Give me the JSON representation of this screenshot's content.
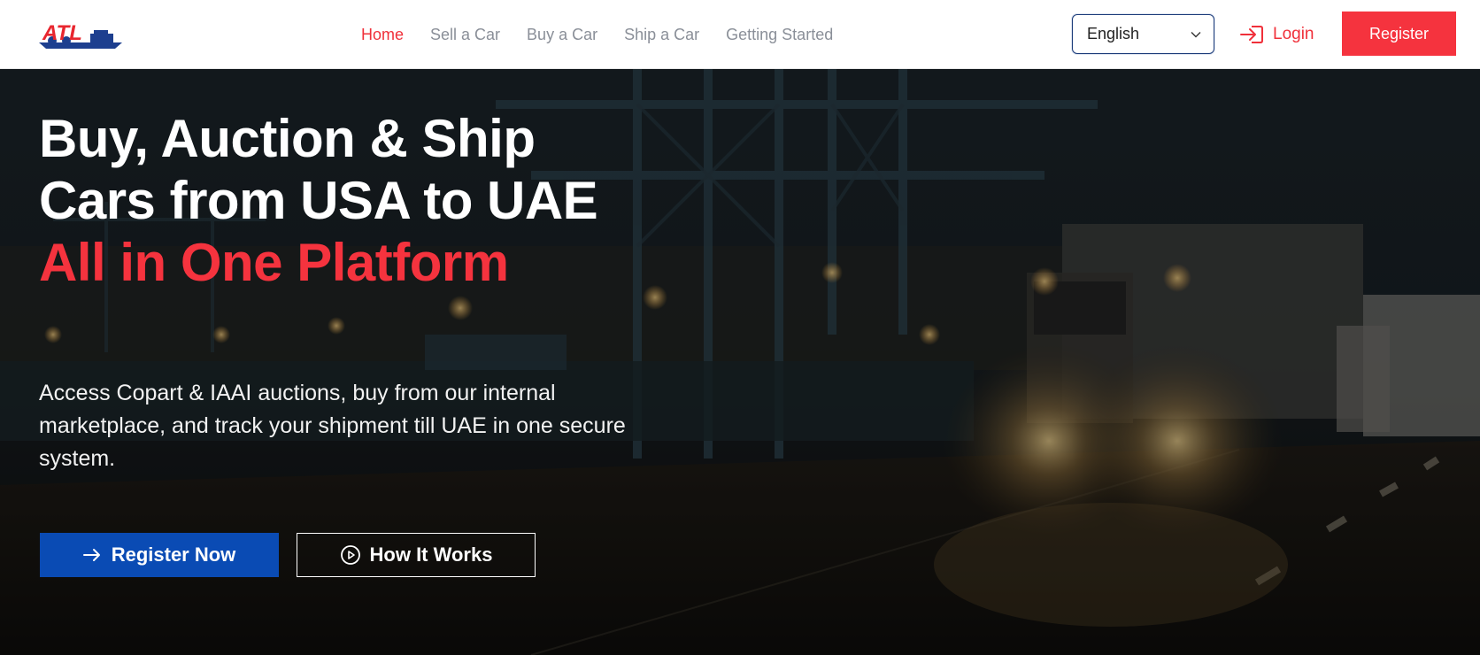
{
  "header": {
    "logo_text": "ATL",
    "nav": [
      {
        "label": "Home",
        "active": true
      },
      {
        "label": "Sell a Car",
        "active": false
      },
      {
        "label": "Buy a Car",
        "active": false
      },
      {
        "label": "Ship a Car",
        "active": false
      },
      {
        "label": "Getting Started",
        "active": false
      }
    ],
    "language": {
      "selected": "English"
    },
    "login_label": "Login",
    "register_label": "Register"
  },
  "hero": {
    "title_line1": "Buy, Auction & Ship",
    "title_line2": "Cars from USA to UAE",
    "title_accent": "All in One Platform",
    "description": "Access Copart & IAAI auctions, buy from our internal marketplace, and track your shipment till UAE in one secure system.",
    "primary_cta": "Register Now",
    "secondary_cta": "How It Works"
  },
  "colors": {
    "accent_red": "#f5333e",
    "primary_blue": "#0a4bb4",
    "nav_gray": "#8a8f98"
  },
  "icons": {
    "login": "login-arrow-icon",
    "register_now": "arrow-right-icon",
    "how_it_works": "play-circle-icon",
    "language": "chevron-down-icon"
  }
}
